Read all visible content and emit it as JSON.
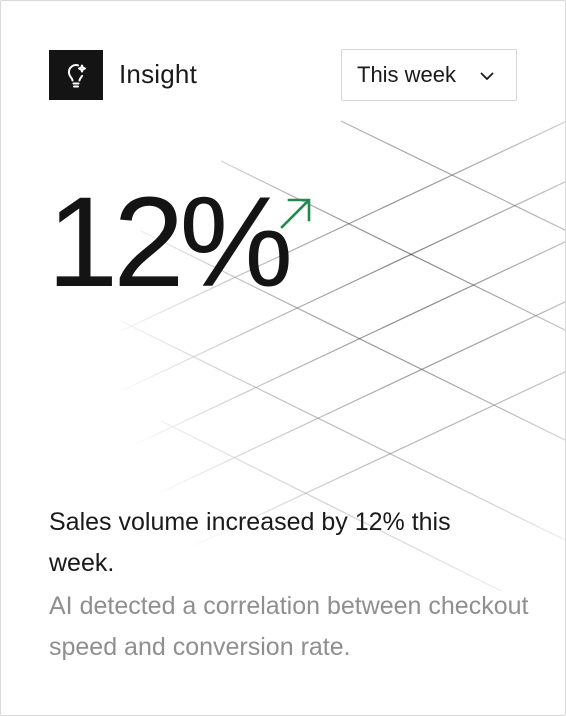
{
  "header": {
    "title": "Insight",
    "icon": "lightbulb-sparkle-icon"
  },
  "period_select": {
    "selected": "This week",
    "icon": "chevron-down-icon"
  },
  "metric": {
    "value": "12%",
    "trend": "up",
    "trend_icon": "arrow-up-right-icon",
    "trend_color": "#1f8a4c"
  },
  "insight": {
    "summary": "Sales volume increased by 12% this week.",
    "detail": "AI detected a correlation between checkout speed and conversion rate."
  },
  "colors": {
    "accent_dark": "#141414",
    "muted_text": "#8f8f8f",
    "positive": "#1f8a4c"
  }
}
